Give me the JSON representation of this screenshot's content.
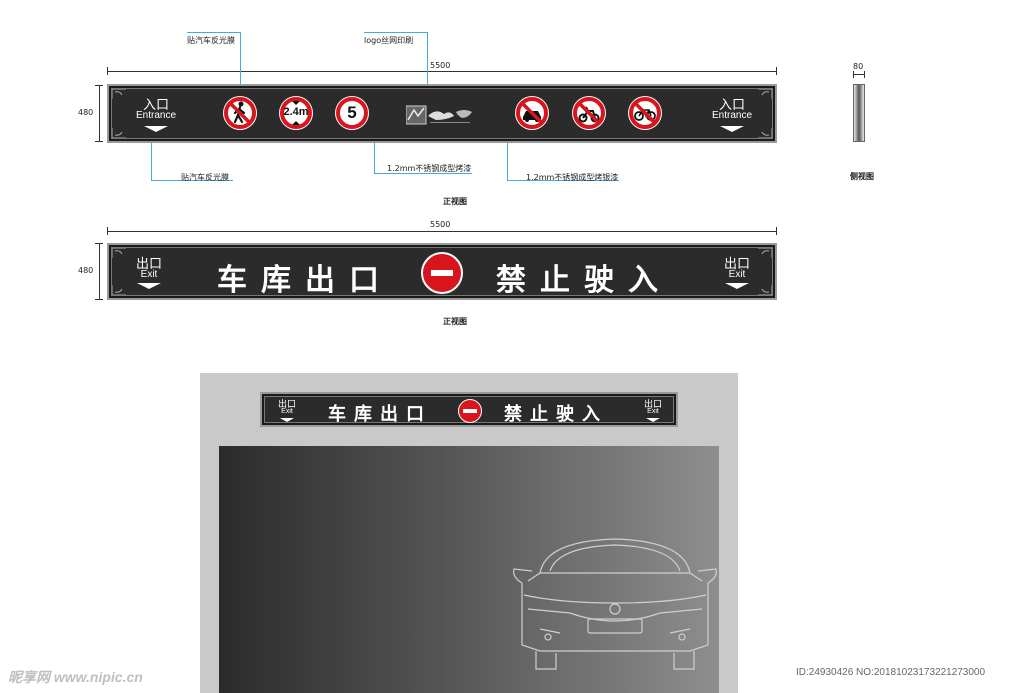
{
  "annotations": {
    "reflective_film_top": "贴汽车反光膜",
    "logo_print": "logo丝网印刷",
    "reflective_film_bottom": "贴汽车反光膜",
    "stainless_paint": "1.2mm不锈钢成型烤漆",
    "stainless_silver": "1.2mm不锈钢成型烤银漆"
  },
  "dimensions": {
    "width_1": "5500",
    "height_1": "480",
    "width_2": "5500",
    "height_2": "480",
    "side_depth": "80"
  },
  "captions": {
    "front_view_1": "正视图",
    "front_view_2": "正视图",
    "side_view": "侧视图"
  },
  "entrance_sign": {
    "left_cn": "入口",
    "left_en": "Entrance",
    "right_cn": "入口",
    "right_en": "Entrance",
    "height_limit": "2.4m",
    "speed_limit": "5"
  },
  "exit_sign": {
    "left_cn": "出口",
    "left_en": "Exit",
    "right_cn": "出口",
    "right_en": "Exit",
    "text_left": "车库出口",
    "text_right": "禁止驶入"
  },
  "mockup_sign": {
    "left_cn": "出口",
    "left_en": "Exit",
    "right_cn": "出口",
    "right_en": "Exit",
    "text_left": "车库出口",
    "text_right": "禁止驶入"
  },
  "watermark": {
    "left": "昵享网 www.nipic.cn",
    "right": "ID:24930426 NO:20181023173221273000"
  },
  "colors": {
    "sign_bg": "#2b2b2b",
    "prohibition_red": "#d8141d",
    "callout_blue": "#4aa8e0"
  }
}
